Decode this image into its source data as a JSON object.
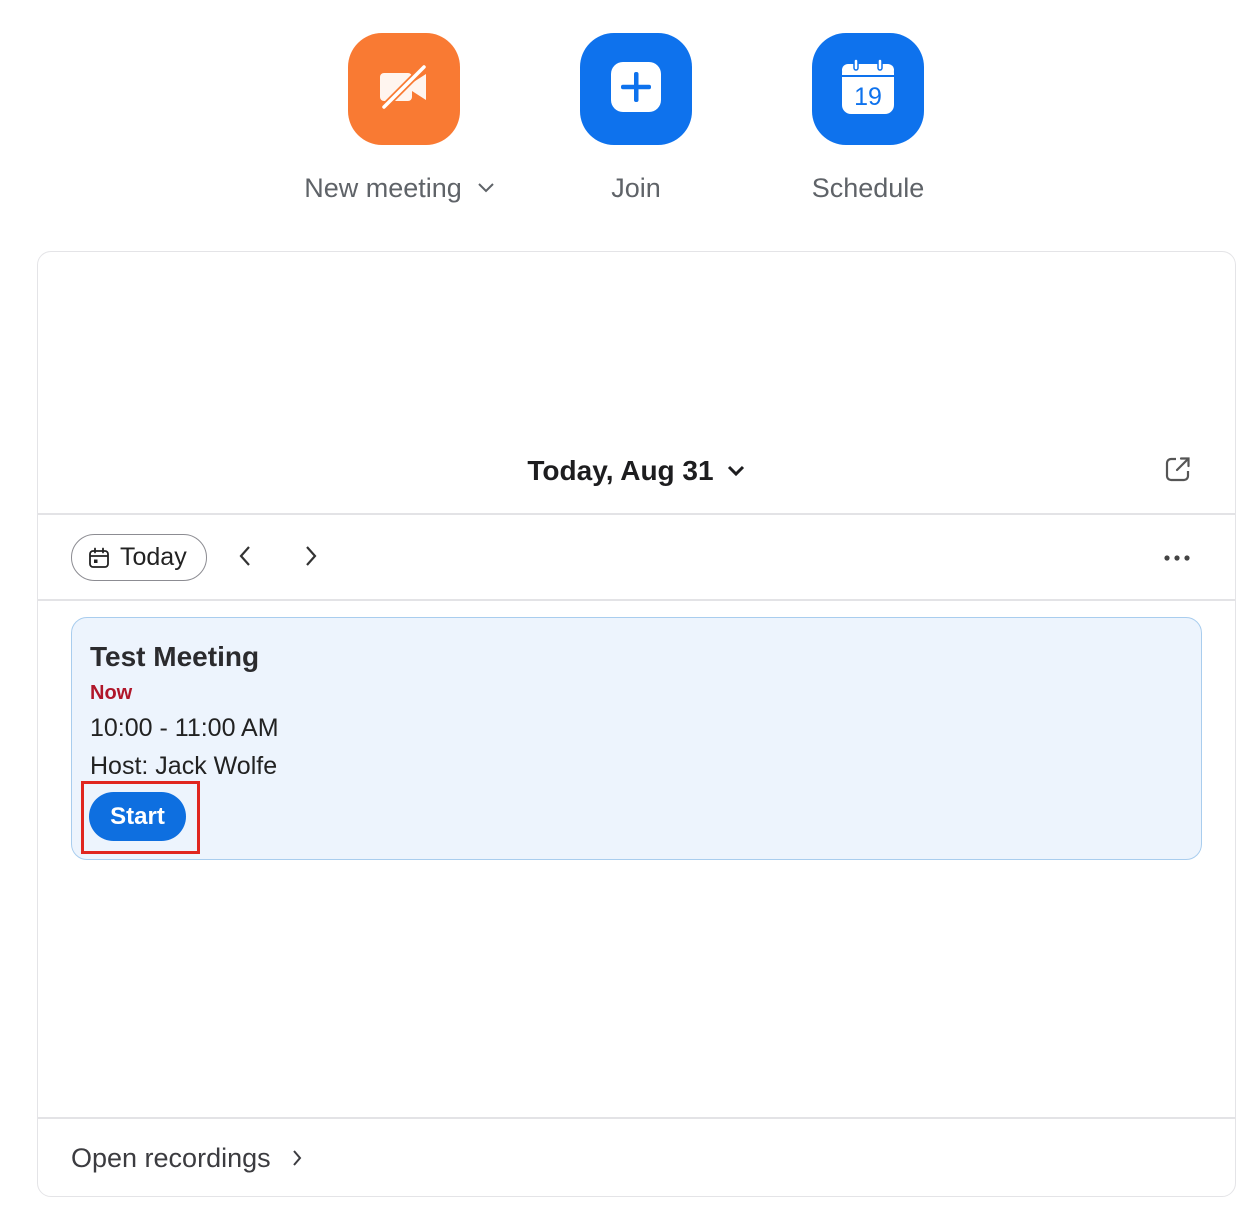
{
  "actions": {
    "new_meeting": {
      "label": "New meeting",
      "color": "#f97a33",
      "icon": "video-off-icon"
    },
    "join": {
      "label": "Join",
      "color": "#0e72ed",
      "icon": "plus-icon"
    },
    "schedule": {
      "label": "Schedule",
      "color": "#0e72ed",
      "icon": "calendar-icon",
      "calendar_day": "19"
    }
  },
  "calendar": {
    "date_title": "Today, Aug 31",
    "today_button": "Today",
    "icons": [
      "chevron-down-icon",
      "popout-icon",
      "calendar-icon",
      "chevron-left-icon",
      "chevron-right-icon",
      "more-icon"
    ]
  },
  "meeting": {
    "title": "Test Meeting",
    "status": "Now",
    "status_color": "#b0162a",
    "time": "10:00 - 11:00 AM",
    "host": "Host: Jack Wolfe",
    "start_label": "Start",
    "start_color": "#0e6fe0",
    "highlight_color": "#e0261f"
  },
  "footer": {
    "open_recordings": "Open recordings"
  }
}
